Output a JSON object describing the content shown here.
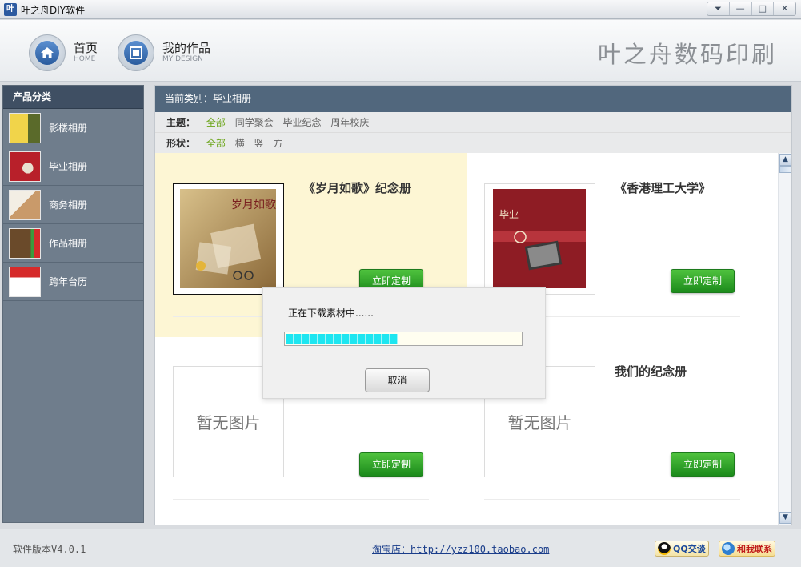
{
  "window": {
    "icon_text": "叶",
    "title": "叶之舟DIY软件",
    "buttons": [
      "⏷",
      "—",
      "□",
      "✕"
    ]
  },
  "header": {
    "nav": [
      {
        "label": "首页",
        "sub": "HOME",
        "icon": "home-icon"
      },
      {
        "label": "我的作品",
        "sub": "MY DESIGN",
        "icon": "my-design-icon"
      }
    ],
    "brand": "叶之舟数码印刷"
  },
  "sidebar": {
    "title": "产品分类",
    "items": [
      {
        "label": "影楼相册",
        "colors": [
          "#f1d44a",
          "#5a6a2a"
        ]
      },
      {
        "label": "毕业相册",
        "colors": [
          "#b8202a",
          "#e9e0d0"
        ]
      },
      {
        "label": "商务相册",
        "colors": [
          "#c99a6a",
          "#f3eee4"
        ]
      },
      {
        "label": "作品相册",
        "colors": [
          "#6a4a2a",
          "#3d9b3d"
        ]
      },
      {
        "label": "跨年台历",
        "colors": [
          "#d62a2a",
          "#ffffff"
        ]
      }
    ]
  },
  "main": {
    "breadcrumb": "当前类别：毕业相册",
    "theme": {
      "label": "主题：",
      "options": [
        "全部",
        "同学聚会",
        "毕业纪念",
        "周年校庆"
      ],
      "active": 0
    },
    "shape": {
      "label": "形状：",
      "options": [
        "全部",
        "横",
        "竖",
        "方"
      ],
      "active": 0
    },
    "cards": [
      {
        "title": "《岁月如歌》纪念册",
        "button": "立即定制",
        "image": "album-cover-vintage"
      },
      {
        "title": "《香港理工大学》",
        "button": "立即定制",
        "image": "album-cover-red"
      },
      {
        "title": "",
        "button": "立即定制",
        "no_image": "暂无图片"
      },
      {
        "title": "我们的纪念册",
        "button": "立即定制",
        "no_image": "暂无图片"
      }
    ]
  },
  "dialog": {
    "message": "正在下载素材中......",
    "progress": 0.48,
    "cancel": "取消"
  },
  "footer": {
    "version": "软件版本V4.0.1",
    "shop_label": "淘宝店：",
    "shop_url": "http://yzz100.taobao.com",
    "qq_label": "QQ交谈",
    "contact_label": "和我联系"
  },
  "colors": {
    "accent_green": "#2aa32a",
    "header_bar": "#51677d",
    "sidebar_bg": "#6f7d8c",
    "progress_fill": "#1ee6f0"
  }
}
